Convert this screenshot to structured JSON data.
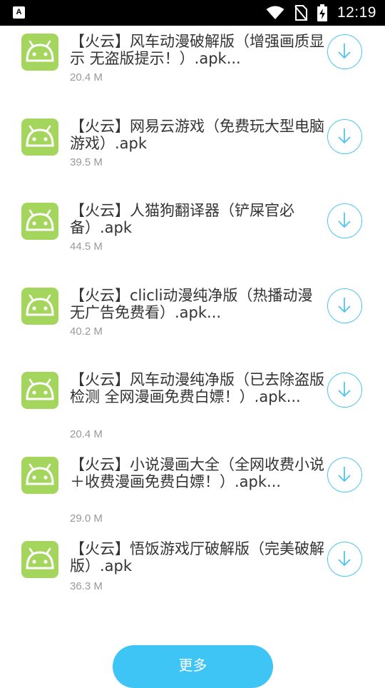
{
  "status_bar": {
    "left_icon_letter": "A",
    "time": "12:19",
    "icons": [
      "wifi-icon",
      "no-sim-icon",
      "battery-charging-icon"
    ]
  },
  "items": [
    {
      "title": "【火云】风车动漫破解版（增强画质显示 无盗版提示！）.apk...",
      "size": "20.4 M"
    },
    {
      "title": "【火云】网易云游戏（免费玩大型电脑游戏）.apk",
      "size": "39.5 M"
    },
    {
      "title": "【火云】人猫狗翻译器（铲屎官必备）.apk",
      "size": "44.5 M"
    },
    {
      "title": "【火云】clicli动漫纯净版（热播动漫无广告免费看）.apk...",
      "size": "40.2 M"
    },
    {
      "title": "【火云】风车动漫纯净版（已去除盗版检测 全网漫画免费白嫖！）.apk...",
      "size": "20.4 M"
    },
    {
      "title": "【火云】小说漫画大全（全网收费小说＋收费漫画免费白嫖！）.apk...",
      "size": "29.0 M"
    },
    {
      "title": "【火云】悟饭游戏厅破解版（完美破解版）.apk",
      "size": "36.3 M"
    }
  ],
  "more_button": {
    "label": "更多"
  },
  "colors": {
    "accent": "#3ec5f5",
    "android_green": "#a4d65e",
    "download_outline": "#4ec6ef"
  }
}
